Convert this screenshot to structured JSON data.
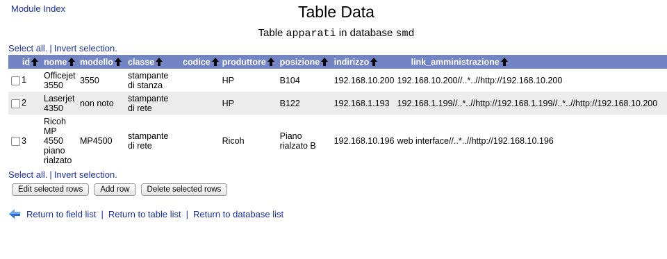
{
  "nav": {
    "module_index": "Module Index"
  },
  "header": {
    "title": "Table Data",
    "subtitle_prefix": "Table ",
    "table_name": "apparati",
    "subtitle_mid": " in database ",
    "database_name": "smd"
  },
  "selection": {
    "select_all": "Select all.",
    "separator": "|",
    "invert": "Invert selection."
  },
  "table": {
    "columns": [
      "id",
      "nome",
      "modello",
      "classe",
      "codice",
      "produttore",
      "posizione",
      "indirizzo",
      "link_amministrazione"
    ],
    "rows": [
      {
        "id": "1",
        "nome": "Officejet 3550",
        "modello": "3550",
        "classe": "stampante di stanza",
        "codice": "",
        "produttore": "HP",
        "posizione": "B104",
        "indirizzo": "192.168.10.200",
        "link_amministrazione": "192.168.10.200//..*..//http://192.168.10.200"
      },
      {
        "id": "2",
        "nome": "Laserjet 4350",
        "modello": "non noto",
        "classe": "stampante di rete",
        "codice": "",
        "produttore": "HP",
        "posizione": "B122",
        "indirizzo": "192.168.1.193",
        "link_amministrazione": "192.168.1.199//..*..//http://192.168.1.199//..*..//http://192.168.10.200"
      },
      {
        "id": "3",
        "nome": "Ricoh MP 4550 piano rialzato",
        "modello": "MP4500",
        "classe": "stampante di rete",
        "codice": "",
        "produttore": "Ricoh",
        "posizione": "Piano rialzato B",
        "indirizzo": "192.168.10.196",
        "link_amministrazione": "web interface//..*..//http://192.168.10.196"
      }
    ]
  },
  "buttons": {
    "edit": "Edit selected rows",
    "add": "Add row",
    "delete": "Delete selected rows"
  },
  "footer": {
    "field_list": "Return to field list",
    "separator": "|",
    "table_list": "Return to table list",
    "database_list": "Return to database list"
  },
  "colors": {
    "header_bg": "#7384c4",
    "link": "#1a2fa8",
    "row_alt": "#ececec"
  },
  "icons": {
    "sort": "arrow-up-icon",
    "back": "back-arrow-icon",
    "checkbox": "checkbox-icon"
  }
}
